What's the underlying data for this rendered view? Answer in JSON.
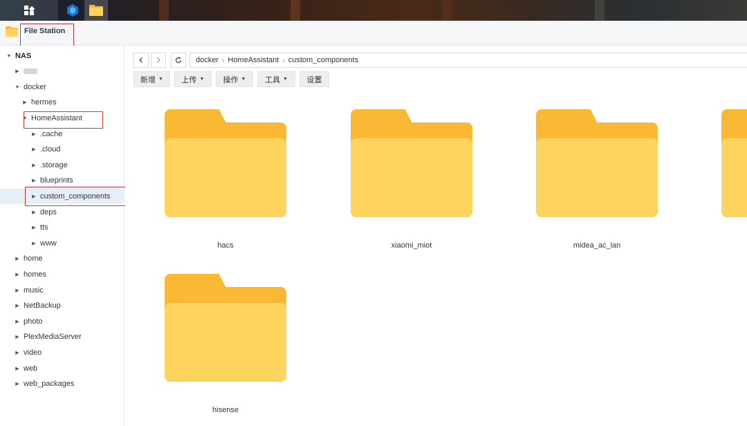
{
  "app": {
    "title": "File Station"
  },
  "colors": {
    "accent_red": "#e0302c",
    "folder_back": "#f9b934",
    "folder_front": "#fed45e",
    "selected_bg": "#e6eef7"
  },
  "sidebar": {
    "root": "NAS",
    "items": [
      {
        "label": "",
        "redacted": true
      },
      {
        "label": "docker"
      },
      {
        "label": "hermes"
      },
      {
        "label": "HomeAssistant"
      },
      {
        "label": ".cache"
      },
      {
        "label": ".cloud"
      },
      {
        "label": ".storage"
      },
      {
        "label": "blueprints"
      },
      {
        "label": "custom_components"
      },
      {
        "label": "deps"
      },
      {
        "label": "tts"
      },
      {
        "label": "www"
      },
      {
        "label": "home"
      },
      {
        "label": "homes"
      },
      {
        "label": "music"
      },
      {
        "label": "NetBackup"
      },
      {
        "label": "photo"
      },
      {
        "label": "PlexMediaServer"
      },
      {
        "label": "video"
      },
      {
        "label": "web"
      },
      {
        "label": "web_packages"
      }
    ]
  },
  "breadcrumb": [
    "docker",
    "HomeAssistant",
    "custom_components"
  ],
  "toolbar": {
    "create": "新增",
    "upload": "上传",
    "action": "操作",
    "tools": "工具",
    "settings": "设置"
  },
  "folders": [
    {
      "name": "hacs"
    },
    {
      "name": "xiaomi_miot"
    },
    {
      "name": "midea_ac_lan"
    },
    {
      "name": ""
    },
    {
      "name": "hisense"
    }
  ]
}
